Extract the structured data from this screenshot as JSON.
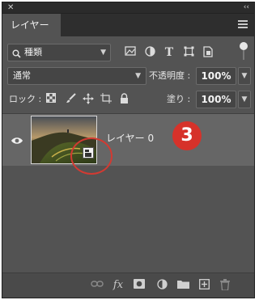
{
  "window": {
    "close_glyph": "✕",
    "collapse_glyph": "‹‹"
  },
  "tabs": [
    {
      "label": "レイヤー"
    }
  ],
  "filter": {
    "kind_label": "種類",
    "icons": [
      "image-filter-icon",
      "adjustment-filter-icon",
      "type-filter-icon",
      "shape-filter-icon",
      "smart-object-filter-icon"
    ]
  },
  "blend": {
    "mode": "通常",
    "opacity_label": "不透明度 :",
    "opacity_value": "100%"
  },
  "lock": {
    "label": "ロック :",
    "fill_label": "塗り :",
    "fill_value": "100%"
  },
  "layers": [
    {
      "name": "レイヤー 0",
      "visible": true
    }
  ],
  "annotation": {
    "number": "3",
    "color": "#d6322a"
  },
  "bottom_icons": [
    "link-icon",
    "fx-icon",
    "mask-icon",
    "adjustment-icon",
    "group-folder-icon",
    "new-layer-icon",
    "trash-icon"
  ],
  "bottom_fx_label": "fx",
  "colors": {
    "panel": "#535353",
    "selected_row": "#666666"
  }
}
